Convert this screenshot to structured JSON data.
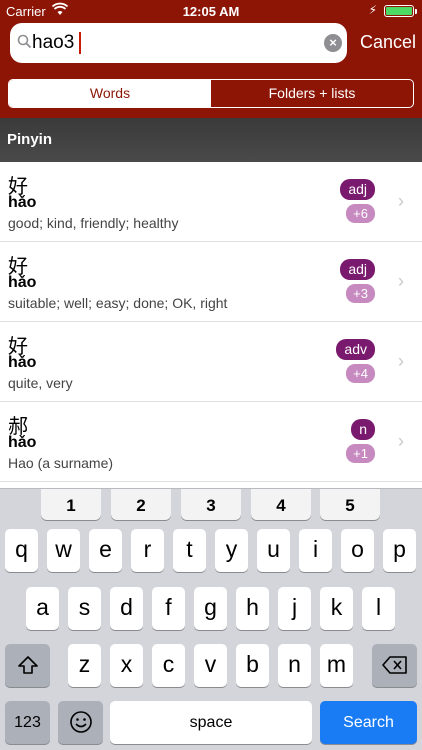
{
  "status": {
    "carrier": "Carrier",
    "time": "12:05 AM"
  },
  "search": {
    "value": "hao3",
    "cancel_label": "Cancel"
  },
  "segments": [
    {
      "label": "Words"
    },
    {
      "label": "Folders + lists"
    }
  ],
  "section_title": "Pinyin",
  "entries": [
    {
      "hanzi": "好",
      "pinyin": "hǎo",
      "definition": "good; kind, friendly; healthy",
      "pos": "adj",
      "more": "+6"
    },
    {
      "hanzi": "好",
      "pinyin": "hǎo",
      "definition": "suitable; well; easy; done; OK, right",
      "pos": "adj",
      "more": "+3"
    },
    {
      "hanzi": "好",
      "pinyin": "hǎo",
      "definition": "quite, very",
      "pos": "adv",
      "more": "+4"
    },
    {
      "hanzi": "郝",
      "pinyin": "hǎo",
      "definition": "Hao (a surname)",
      "pos": "n",
      "more": "+1"
    }
  ],
  "keyboard": {
    "numbers": [
      "1",
      "2",
      "3",
      "4",
      "5"
    ],
    "row1": [
      "q",
      "w",
      "e",
      "r",
      "t",
      "y",
      "u",
      "i",
      "o",
      "p"
    ],
    "row2": [
      "a",
      "s",
      "d",
      "f",
      "g",
      "h",
      "j",
      "k",
      "l"
    ],
    "row3": [
      "z",
      "x",
      "c",
      "v",
      "b",
      "n",
      "m"
    ],
    "numbers_key": "123",
    "space_label": "space",
    "search_label": "Search"
  },
  "colors": {
    "header": "#8c1506",
    "pos_badge": "#7a1a6e",
    "more_badge": "#c689c0",
    "search_key": "#1a7cf5"
  }
}
